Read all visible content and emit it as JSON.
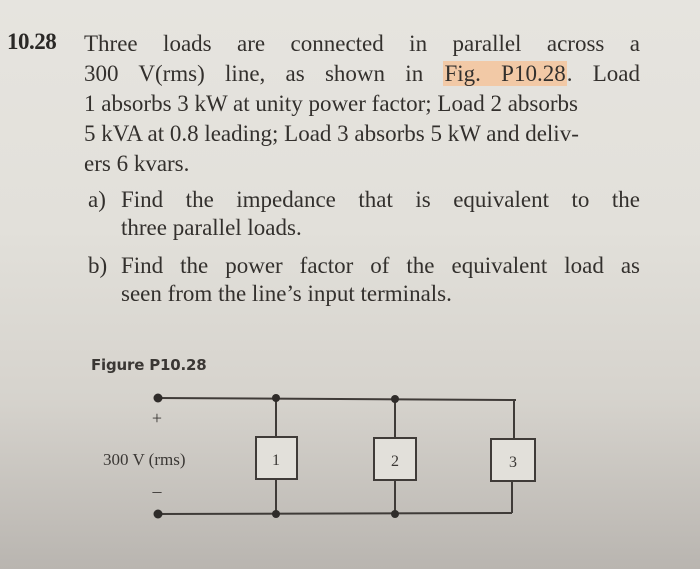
{
  "problem": {
    "number": "10.28",
    "lines": [
      "Three loads are connected in parallel across a",
      "300 V(rms) line, as shown in",
      "Fig. P10.28",
      ". Load",
      "1 absorbs 3 kW at unity power factor; Load 2 absorbs",
      "5 kVA at 0.8 leading; Load 3 absorbs 5 kW and deliv-",
      "ers 6 kvars."
    ],
    "highlight_color": "#f2c9a6"
  },
  "parts": [
    {
      "label": "a)",
      "lines": [
        "Find the impedance that is equivalent to the",
        "three parallel loads."
      ]
    },
    {
      "label": "b)",
      "lines": [
        "Find the power factor of the equivalent load as",
        "seen from the line’s input terminals."
      ]
    }
  ],
  "figure": {
    "title": "Figure P10.28",
    "source_label": "300 V (rms)",
    "plus_sign": "+",
    "minus_sign": "–",
    "loads": [
      "1",
      "2",
      "3"
    ]
  }
}
